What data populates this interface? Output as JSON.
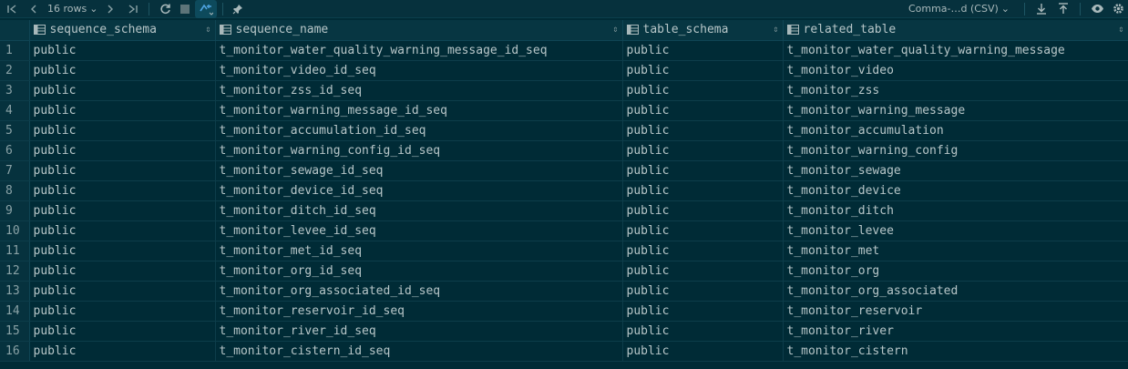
{
  "toolbar": {
    "rows_label": "16 rows",
    "export_label": "Comma-…d (CSV)",
    "icons": [
      "first-page-icon",
      "prev-page-icon",
      "next-page-icon",
      "last-page-icon",
      "refresh-icon",
      "stop-icon",
      "compare-icon",
      "pin-icon",
      "download-icon",
      "upload-icon",
      "eye-icon",
      "gear-icon"
    ]
  },
  "columns": [
    "sequence_schema",
    "sequence_name",
    "table_schema",
    "related_table"
  ],
  "rows": [
    {
      "n": "1",
      "schema": "public",
      "seq": "t_monitor_water_quality_warning_message_id_seq",
      "tschema": "public",
      "table": "t_monitor_water_quality_warning_message"
    },
    {
      "n": "2",
      "schema": "public",
      "seq": "t_monitor_video_id_seq",
      "tschema": "public",
      "table": "t_monitor_video"
    },
    {
      "n": "3",
      "schema": "public",
      "seq": "t_monitor_zss_id_seq",
      "tschema": "public",
      "table": "t_monitor_zss"
    },
    {
      "n": "4",
      "schema": "public",
      "seq": "t_monitor_warning_message_id_seq",
      "tschema": "public",
      "table": "t_monitor_warning_message"
    },
    {
      "n": "5",
      "schema": "public",
      "seq": "t_monitor_accumulation_id_seq",
      "tschema": "public",
      "table": "t_monitor_accumulation"
    },
    {
      "n": "6",
      "schema": "public",
      "seq": "t_monitor_warning_config_id_seq",
      "tschema": "public",
      "table": "t_monitor_warning_config"
    },
    {
      "n": "7",
      "schema": "public",
      "seq": "t_monitor_sewage_id_seq",
      "tschema": "public",
      "table": "t_monitor_sewage"
    },
    {
      "n": "8",
      "schema": "public",
      "seq": "t_monitor_device_id_seq",
      "tschema": "public",
      "table": "t_monitor_device"
    },
    {
      "n": "9",
      "schema": "public",
      "seq": "t_monitor_ditch_id_seq",
      "tschema": "public",
      "table": "t_monitor_ditch"
    },
    {
      "n": "10",
      "schema": "public",
      "seq": "t_monitor_levee_id_seq",
      "tschema": "public",
      "table": "t_monitor_levee"
    },
    {
      "n": "11",
      "schema": "public",
      "seq": "t_monitor_met_id_seq",
      "tschema": "public",
      "table": "t_monitor_met"
    },
    {
      "n": "12",
      "schema": "public",
      "seq": "t_monitor_org_id_seq",
      "tschema": "public",
      "table": "t_monitor_org"
    },
    {
      "n": "13",
      "schema": "public",
      "seq": "t_monitor_org_associated_id_seq",
      "tschema": "public",
      "table": "t_monitor_org_associated"
    },
    {
      "n": "14",
      "schema": "public",
      "seq": "t_monitor_reservoir_id_seq",
      "tschema": "public",
      "table": "t_monitor_reservoir"
    },
    {
      "n": "15",
      "schema": "public",
      "seq": "t_monitor_river_id_seq",
      "tschema": "public",
      "table": "t_monitor_river"
    },
    {
      "n": "16",
      "schema": "public",
      "seq": "t_monitor_cistern_id_seq",
      "tschema": "public",
      "table": "t_monitor_cistern"
    }
  ]
}
